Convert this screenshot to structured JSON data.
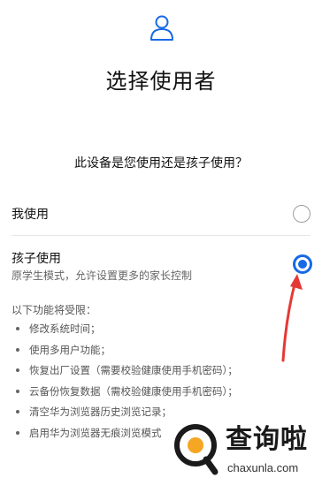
{
  "header": {
    "icon": "user-icon",
    "title": "选择使用者"
  },
  "question": "此设备是您使用还是孩子使用？",
  "options": [
    {
      "label": "我使用",
      "selected": false
    },
    {
      "label": "孩子使用",
      "description": "原学生模式，允许设置更多的家长控制",
      "selected": true
    }
  ],
  "restrictions": {
    "heading": "以下功能将受限：",
    "items": [
      "修改系统时间；",
      "使用多用户功能；",
      "恢复出厂设置（需要校验健康使用手机密码）；",
      "云备份恢复数据（需校验健康使用手机密码）；",
      "清空华为浏览器历史浏览记录；",
      "启用华为浏览器无痕浏览模式"
    ]
  },
  "watermark": {
    "brand": "查询啦",
    "domain": "chaxunla.com"
  },
  "colors": {
    "accent": "#1769e6",
    "arrow": "#e53935",
    "icon": "#1769e6"
  }
}
